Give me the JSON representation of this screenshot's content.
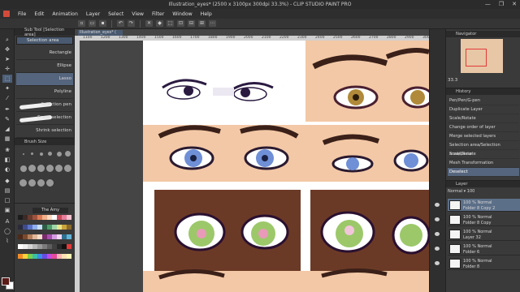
{
  "window": {
    "title": "Illustration_eyes* (2500 x 3100px 300dpi 33.3%) - CLIP STUDIO PAINT PRO",
    "controls": [
      "—",
      "❐",
      "✕"
    ]
  },
  "menu": [
    "File",
    "Edit",
    "Animation",
    "Layer",
    "Select",
    "View",
    "Filter",
    "Window",
    "Help"
  ],
  "subtool_panel": {
    "header": "Sub Tool [Selection area]",
    "tab": "Selection area",
    "items": [
      "Rectangle",
      "Ellipse",
      "Lasso",
      "Polyline",
      "Selection pen",
      "Erase selection",
      "Shrink selection"
    ],
    "selected": "Lasso"
  },
  "brush_size": {
    "header": "Brush Size"
  },
  "color_set": {
    "title": "The Amy",
    "colors": [
      "#1c1c1c",
      "#3b2a25",
      "#6a3b2f",
      "#a0523c",
      "#d97a55",
      "#f2b08a",
      "#ffd9bf",
      "#ffffff",
      "#c94b5c",
      "#e67e9a",
      "#f7c1cf",
      "#2a2a3a",
      "#3f4c8c",
      "#5b74c8",
      "#8fb0ee",
      "#c6dcf9",
      "#2e5d46",
      "#4e9c6a",
      "#9fd6a8",
      "#e8e48a",
      "#c9a43c",
      "#8a6a2a",
      "#4b2a1a",
      "#7a4a2e",
      "#b5805c",
      "#e0b89a",
      "#f5dcc8",
      "#7a2b6e",
      "#a84fb0",
      "#d49be0",
      "#f1d6f4",
      "#2f6f8f",
      "#63b3d6",
      "#ffffff",
      "#efefef",
      "#d5d5d5",
      "#b8b8b8",
      "#9a9a9a",
      "#7c7c7c",
      "#5e5e5e",
      "#404040",
      "#282828",
      "#111111",
      "#e33a3a",
      "#f28c28",
      "#f7d43a",
      "#7ccf4a",
      "#3ac0a8",
      "#3a8ee3",
      "#6b4ae3",
      "#c24ae3",
      "#e34a9a",
      "#ffb3b3",
      "#ffe0b3",
      "#fff6b3"
    ],
    "selected_fg": "#5a1a16"
  },
  "document": {
    "tab": "Illustration_eyes* (",
    "ruler_ticks": [
      "1100",
      "1200",
      "1300",
      "1400",
      "1500",
      "1600",
      "1700",
      "1800",
      "1900",
      "2000",
      "2100",
      "2200",
      "2300",
      "2400",
      "2500",
      "2600",
      "2700",
      "2800",
      "2900",
      "3000"
    ]
  },
  "navigator": {
    "header": "Navigator",
    "zoom": "33.3"
  },
  "history": {
    "header": "History",
    "items": [
      "Pen/Pen/G-pen",
      "Duplicate Layer",
      "Scale/Rotate",
      "Change order of layer",
      "Merge selected layers",
      "Selection area/Selection area/Lasso",
      "Scale/Rotate",
      "Mesh Transformation",
      "Deselect"
    ],
    "selected": "Deselect"
  },
  "layers": {
    "header": "Layer",
    "blend_mode": "Normal",
    "opacity": "100",
    "rows": [
      {
        "l1": "100 % Normal",
        "l2": "Folder 8 Copy 2",
        "selected": true
      },
      {
        "l1": "100 % Normal",
        "l2": "Folder 8 Copy",
        "selected": false
      },
      {
        "l1": "100 % Normal",
        "l2": "Layer 32",
        "selected": false
      },
      {
        "l1": "100 % Normal",
        "l2": "Folder 6",
        "selected": false
      },
      {
        "l1": "100 % Normal",
        "l2": "Folder 8",
        "selected": false
      }
    ]
  },
  "colors": {
    "ui_dark": "#2f2f2f",
    "ui_panel": "#3a3a3a",
    "selection_blue": "#55657d",
    "skin_light": "#f3c8a6",
    "skin_dark": "#6b3a26",
    "iris_blue": "#6f8fd6",
    "iris_green": "#9cc86a",
    "iris_gold": "#b08a3a"
  }
}
